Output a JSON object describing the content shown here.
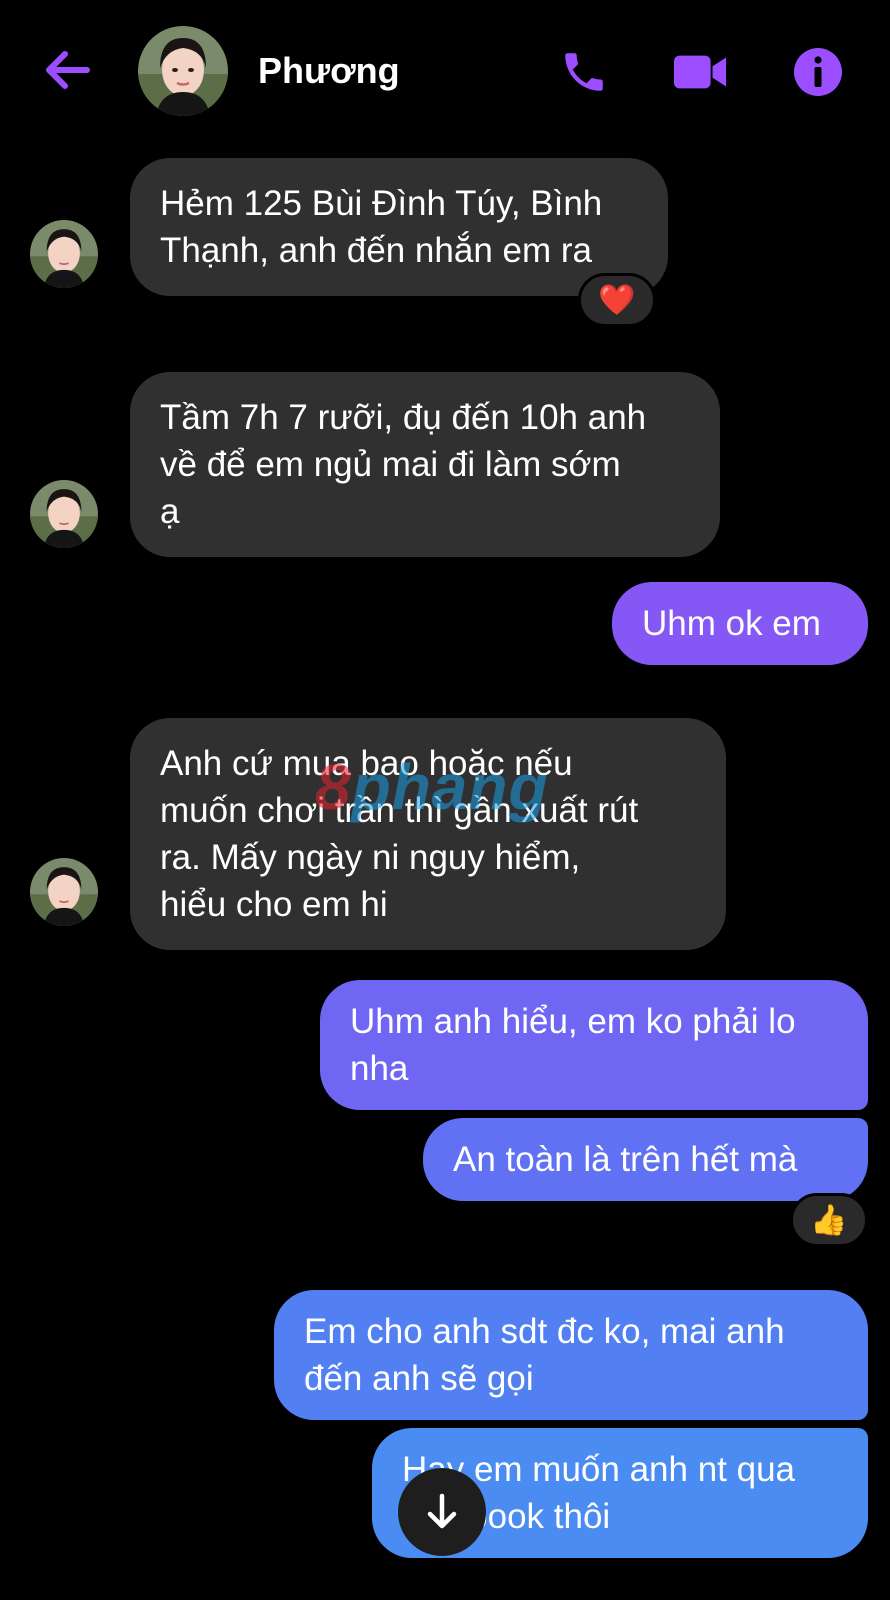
{
  "header": {
    "contact_name": "Phương",
    "back_icon": "arrow-left-icon",
    "call_icon": "phone-icon",
    "video_icon": "video-camera-icon",
    "info_icon": "info-icon",
    "accent_color": "#9b4dff"
  },
  "messages": [
    {
      "direction": "incoming",
      "text": "Hẻm 125 Bùi Đình Túy, Bình\nThạnh, anh đến nhắn em ra",
      "reaction": "❤️"
    },
    {
      "direction": "incoming",
      "text": "Tầm 7h 7 rưỡi, đụ đến 10h anh\nvề để em ngủ mai đi làm sớm\nạ"
    },
    {
      "direction": "outgoing",
      "text": "Uhm ok em"
    },
    {
      "direction": "incoming",
      "text": "Anh cứ mua bao hoặc nếu\nmuốn chơi trần thì gần xuất rút\nra. Mấy ngày ni nguy hiểm,\nhiểu cho em hi"
    },
    {
      "direction": "outgoing",
      "text": "Uhm anh hiểu, em ko phải lo\nnha"
    },
    {
      "direction": "outgoing",
      "text": "An toàn là trên hết mà",
      "reaction": "👍"
    },
    {
      "direction": "outgoing",
      "text": "Em cho anh sdt đc ko, mai anh\nđến anh sẽ gọi"
    },
    {
      "direction": "outgoing",
      "text": "Hay em muốn anh nt qua\nfacebook thôi"
    }
  ],
  "watermark": {
    "part1": "8",
    "part2": "phang"
  },
  "scroll_down_icon": "arrow-down-icon",
  "colors": {
    "incoming_bubble": "#303030",
    "outgoing_top": "#8a56f5",
    "outgoing_bottom": "#4a8cf2"
  }
}
